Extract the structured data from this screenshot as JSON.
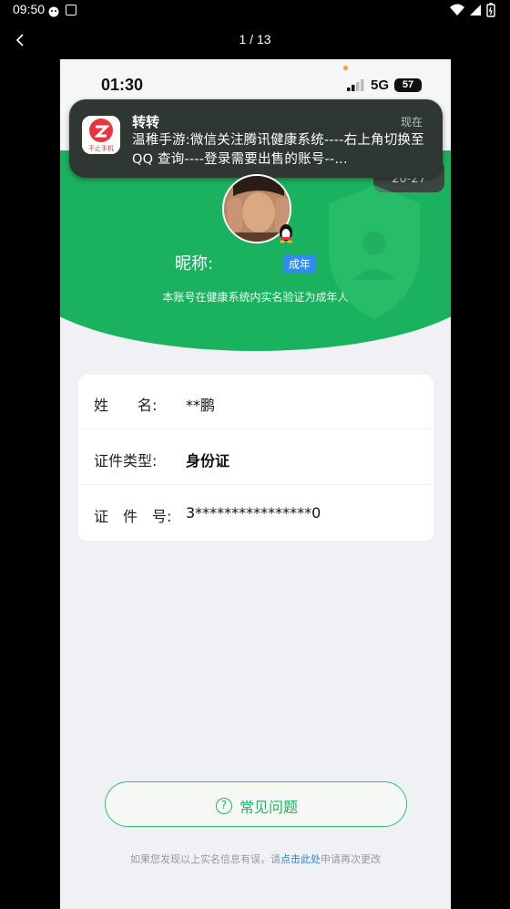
{
  "android_status": {
    "time": "09:50"
  },
  "viewer": {
    "counter": "1 / 13"
  },
  "ios_status": {
    "time": "01:30",
    "network": "5G",
    "battery": "57"
  },
  "notification": {
    "app_name": "转转",
    "time": "现在",
    "body": "温稚手游:微信关注腾讯健康系统----右上角切换至 QQ 查询----登录需要出售的账号--...",
    "date_tag": "20-27",
    "app_icon_label": "不止手机"
  },
  "hero": {
    "nickname_label": "昵称:",
    "adult_badge": "成年",
    "description": "本账号在健康系统内实名验证为成年人"
  },
  "info": {
    "rows": [
      {
        "label": "姓　　名:",
        "value": "**鹏"
      },
      {
        "label": "证件类型:",
        "value": "身份证"
      },
      {
        "label": "证　件　号:",
        "value": "3****************0"
      }
    ]
  },
  "faq": {
    "label": "常见问题"
  },
  "tip": {
    "before": "如果您发现以上实名信息有误，请",
    "link": "点击此处",
    "after": "申请再次更改"
  },
  "colors": {
    "green": "#1bb25f",
    "blue": "#2c8cf0",
    "link": "#2a7de1"
  }
}
